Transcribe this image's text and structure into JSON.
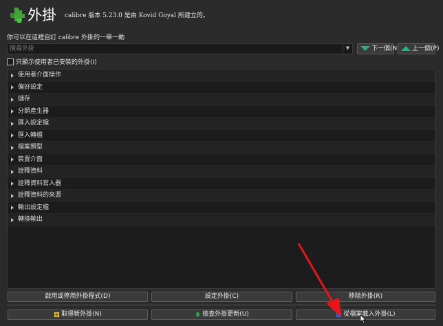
{
  "header": {
    "title": "外掛",
    "subtitle": "calibre 版本 5.23.0 是由 Kovid Goyal 所建立的。"
  },
  "hint": "你可以在這裡自訂 calibre 外掛的一舉一動",
  "search": {
    "placeholder": "搜尋外掛"
  },
  "nav": {
    "next_label": "下一個(N)",
    "prev_label": "上一個(P)"
  },
  "filter": {
    "label": "只顯示使用者已安裝的外掛(I)"
  },
  "tree": {
    "items": [
      "使用者介面操作",
      "偏好設定",
      "儲存",
      "分類產生器",
      "匯入設定檔",
      "匯入轉檔",
      "檔案類型",
      "裝置介面",
      "詮釋資料",
      "詮釋資料寫入器",
      "詮釋資料的來源",
      "輸出設定檔",
      "轉換輸出"
    ]
  },
  "actions": {
    "toggle_label": "啟用或停用外掛程式(D)",
    "customize_label": "設定外掛(C)",
    "remove_label": "移除外掛(R)",
    "get_new_label": "取得新外掛(N)",
    "check_updates_label": "檢查外掛更新(U)",
    "load_file_label": "從檔案載入外掛(L)"
  },
  "colors": {
    "accent_green": "#27b27a",
    "annotation_red": "#e8141a",
    "background": "#2b2b2b"
  }
}
